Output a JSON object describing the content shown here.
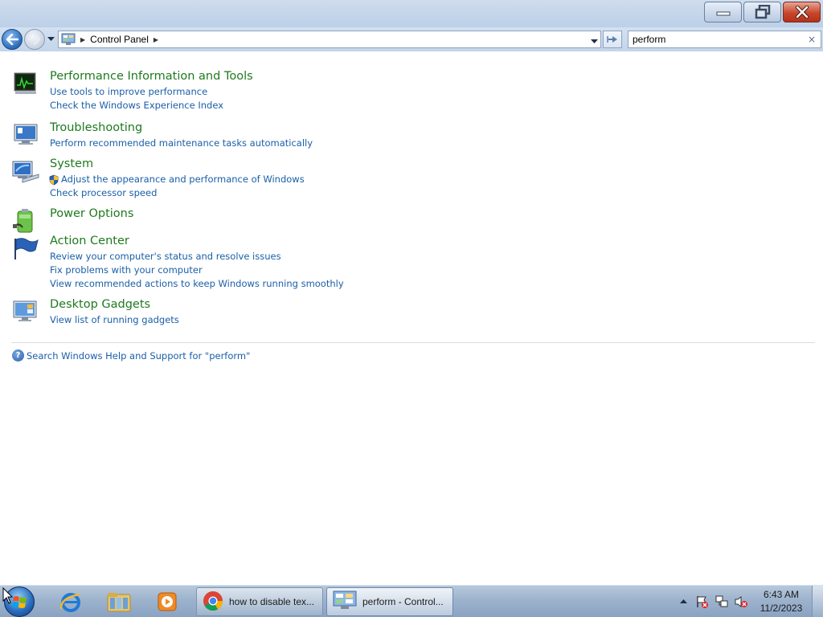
{
  "window": {
    "minimize_label": "",
    "maximize_label": "",
    "close_label": ""
  },
  "navigation": {
    "breadcrumb": [
      "Control Panel"
    ],
    "search_value": "perform",
    "search_clear": "×"
  },
  "results": [
    {
      "title": "Performance Information and Tools",
      "icon": "performance-meter-icon",
      "links": [
        {
          "text": "Use tools to improve performance",
          "shield": false
        },
        {
          "text": "Check the Windows Experience Index",
          "shield": false
        }
      ]
    },
    {
      "title": "Troubleshooting",
      "icon": "troubleshooting-monitor-icon",
      "links": [
        {
          "text": "Perform recommended maintenance tasks automatically",
          "shield": false
        }
      ]
    },
    {
      "title": "System",
      "icon": "system-computer-icon",
      "links": [
        {
          "text": "Adjust the appearance and performance of Windows",
          "shield": true
        },
        {
          "text": "Check processor speed",
          "shield": false
        }
      ]
    },
    {
      "title": "Power Options",
      "icon": "power-battery-icon",
      "links": []
    },
    {
      "title": "Action Center",
      "icon": "action-center-flag-icon",
      "links": [
        {
          "text": "Review your computer's status and resolve issues",
          "shield": false
        },
        {
          "text": "Fix problems with your computer",
          "shield": false
        },
        {
          "text": "View recommended actions to keep Windows running smoothly",
          "shield": false
        }
      ]
    },
    {
      "title": "Desktop Gadgets",
      "icon": "desktop-gadgets-icon",
      "links": [
        {
          "text": "View list of running gadgets",
          "shield": false
        }
      ]
    }
  ],
  "help": {
    "text": "Search Windows Help and Support for \"perform\""
  },
  "taskbar": {
    "pinned": [
      "internet-explorer-icon",
      "file-explorer-icon",
      "media-player-icon"
    ],
    "tasks": [
      {
        "label": "how to disable tex...",
        "icon": "chrome-icon",
        "active": false
      },
      {
        "label": "perform - Control...",
        "icon": "control-panel-icon",
        "active": true
      }
    ],
    "clock_time": "6:43 AM",
    "clock_date": "11/2/2023",
    "tray_icons": [
      "show-hidden-icons-arrow",
      "action-center-flag-icon",
      "network-icon",
      "volume-muted-icon"
    ]
  },
  "colors": {
    "title_green": "#1e7a1e",
    "link_blue": "#1a5fa8",
    "close_red": "#c7472d"
  }
}
